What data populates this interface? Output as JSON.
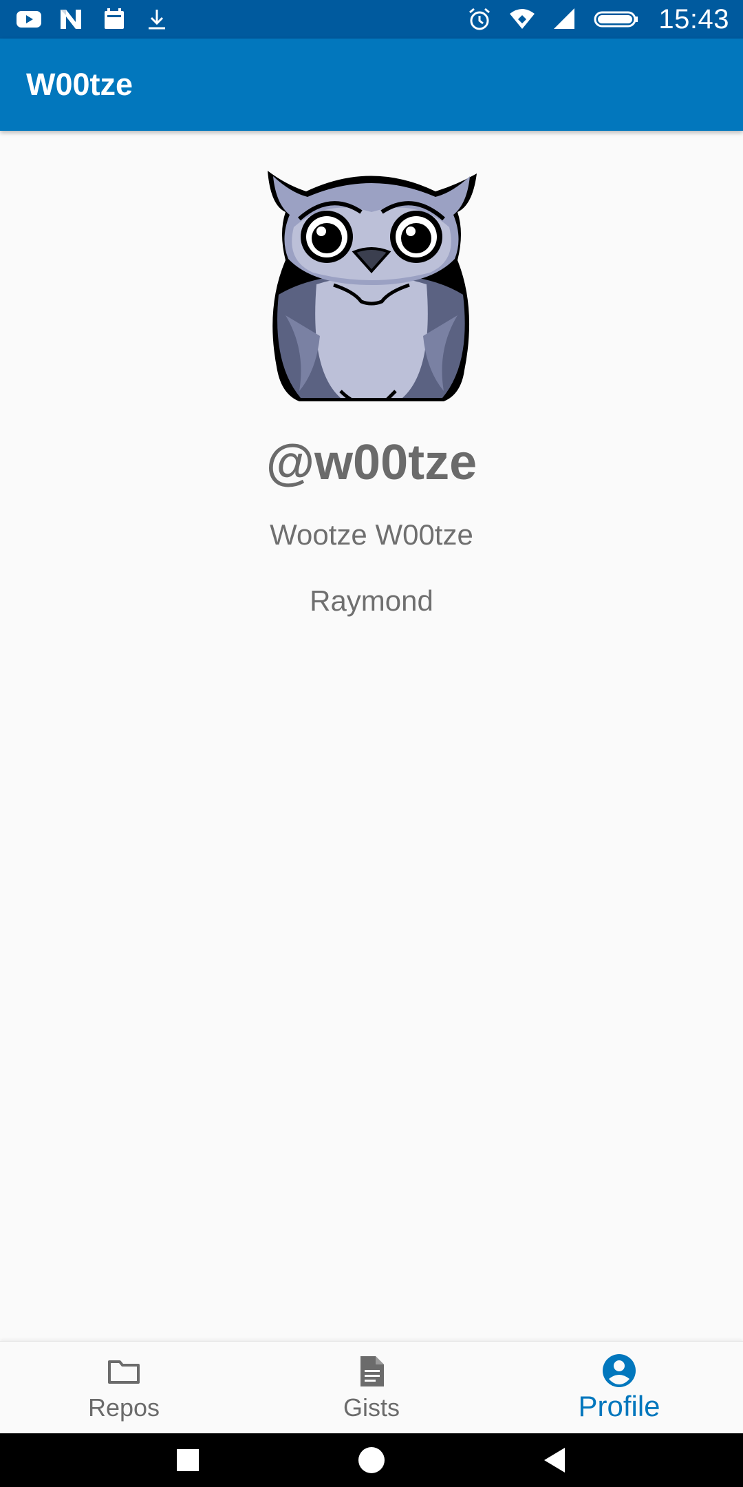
{
  "status_bar": {
    "time": "15:43",
    "left_icons": [
      "youtube-icon",
      "n-notification-icon",
      "calendar-icon",
      "download-icon"
    ],
    "right_icons": [
      "alarm-icon",
      "wifi-icon",
      "signal-icon",
      "battery-icon"
    ]
  },
  "app_bar": {
    "title": "W00tze"
  },
  "profile": {
    "avatar_icon": "owl-avatar",
    "username": "@w00tze",
    "full_name": "Wootze W00tze",
    "company": "Raymond"
  },
  "bottom_nav": {
    "items": [
      {
        "label": "Repos",
        "icon": "folder-icon",
        "active": false
      },
      {
        "label": "Gists",
        "icon": "file-icon",
        "active": false
      },
      {
        "label": "Profile",
        "icon": "account-icon",
        "active": true
      }
    ]
  },
  "colors": {
    "status_bar": "#005a9e",
    "app_bar": "#0277bd",
    "accent": "#0277bd",
    "text_secondary": "#6b6b6b",
    "background": "#fafafa"
  }
}
